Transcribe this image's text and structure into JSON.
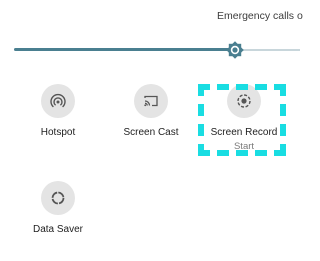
{
  "status_bar": {
    "emergency_text": "Emergency calls o"
  },
  "brightness": {
    "level_percent": 77,
    "accent_color": "#4a7f90",
    "thumb_icon": "brightness-icon"
  },
  "tiles": [
    {
      "label": "Hotspot",
      "icon": "hotspot-icon"
    },
    {
      "label": "Screen Cast",
      "icon": "cast-icon"
    },
    {
      "label": "Screen Record",
      "sublabel": "Start",
      "icon": "screen-record-icon"
    },
    {
      "label": "Data Saver",
      "icon": "data-saver-icon"
    }
  ],
  "highlight_color": "#19dde2"
}
